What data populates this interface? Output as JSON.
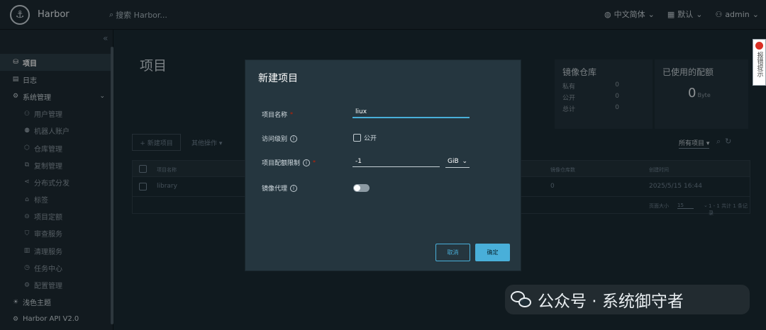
{
  "header": {
    "brand": "Harbor",
    "search_placeholder": "搜索 Harbor...",
    "language": "中文简体",
    "date_format": "默认",
    "user": "admin"
  },
  "sidebar": {
    "collapse_glyph": "«",
    "items": [
      {
        "label": "项目",
        "icon": "project-icon",
        "glyph": "⛁",
        "active": true
      },
      {
        "label": "日志",
        "icon": "log-icon",
        "glyph": "▤"
      },
      {
        "label": "系统管理",
        "icon": "admin-icon",
        "glyph": "⚙",
        "expandable": true
      },
      {
        "label": "用户管理",
        "icon": "users-icon",
        "glyph": "⚇"
      },
      {
        "label": "机器人账户",
        "icon": "robot-icon",
        "glyph": "⚉"
      },
      {
        "label": "仓库管理",
        "icon": "registry-icon",
        "glyph": "⬡"
      },
      {
        "label": "复制管理",
        "icon": "replication-icon",
        "glyph": "⧉"
      },
      {
        "label": "分布式分发",
        "icon": "distribution-icon",
        "glyph": "⋖"
      },
      {
        "label": "标签",
        "icon": "tag-icon",
        "glyph": "⌂"
      },
      {
        "label": "项目定额",
        "icon": "quota-icon",
        "glyph": "⊝"
      },
      {
        "label": "审查服务",
        "icon": "shield-icon",
        "glyph": "⛉"
      },
      {
        "label": "清理服务",
        "icon": "trash-icon",
        "glyph": "▥"
      },
      {
        "label": "任务中心",
        "icon": "clock-icon",
        "glyph": "◷"
      },
      {
        "label": "配置管理",
        "icon": "settings-icon",
        "glyph": "⚙"
      },
      {
        "label": "浅色主题",
        "icon": "sun-icon",
        "glyph": "☀"
      },
      {
        "label": "Harbor API V2.0",
        "icon": "api-icon",
        "glyph": "⚙"
      }
    ]
  },
  "page": {
    "title": "项目",
    "repo_card": {
      "title": "镜像仓库",
      "rows": [
        {
          "label": "私有",
          "value": "0"
        },
        {
          "label": "公开",
          "value": "0"
        },
        {
          "label": "总计",
          "value": "0"
        }
      ]
    },
    "quota_card": {
      "title": "已使用的配额",
      "value": "0",
      "unit": "Byte"
    },
    "new_project_button": "+ 新建项目",
    "other_actions": "其他操作 ▾",
    "filter": "所有项目 ▾",
    "table": {
      "headers": [
        "项目名称",
        "镜像仓库数",
        "创建时间"
      ],
      "rows": [
        {
          "name": "library",
          "repo_count": "0",
          "created": "2025/5/15 16:44"
        }
      ],
      "page_size_label": "页面大小",
      "page_size": "15",
      "summary": "1 - 1 共计 1 条记录"
    }
  },
  "modal": {
    "title": "新建项目",
    "name_label": "项目名称",
    "name_required": "*",
    "name_value": "liux",
    "access_label": "访问级别",
    "public_label": "公开",
    "quota_label": "项目配额限制",
    "quota_required": "*",
    "quota_value": "-1",
    "quota_unit": "GiB",
    "proxy_label": "镜像代理",
    "cancel": "取消",
    "ok": "确定"
  },
  "side_tab": {
    "text": "报错提示"
  },
  "watermark": {
    "text": "公众号 · 系统御守者"
  }
}
